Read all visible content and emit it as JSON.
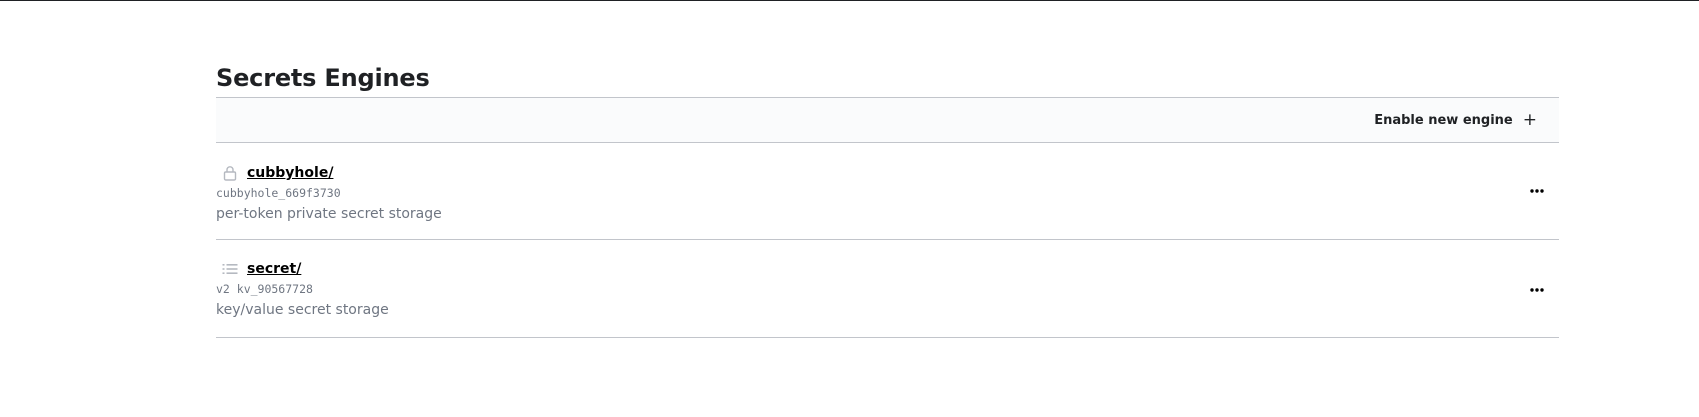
{
  "page": {
    "title": "Secrets Engines"
  },
  "toolbar": {
    "enable_label": "Enable new engine",
    "enable_icon": "plus-icon"
  },
  "engines": [
    {
      "path": "cubbyhole/",
      "accessor": "cubbyhole_669f3730",
      "description": "per-token private secret storage",
      "icon": "lock-icon"
    },
    {
      "path": "secret/",
      "accessor": "v2 kv_90567728",
      "description": "key/value secret storage",
      "icon": "list-icon"
    }
  ],
  "colors": {
    "text": "#1f2124",
    "muted": "#6f7682",
    "border": "#c2c5cb",
    "toolbar_bg": "#fafbfc"
  }
}
